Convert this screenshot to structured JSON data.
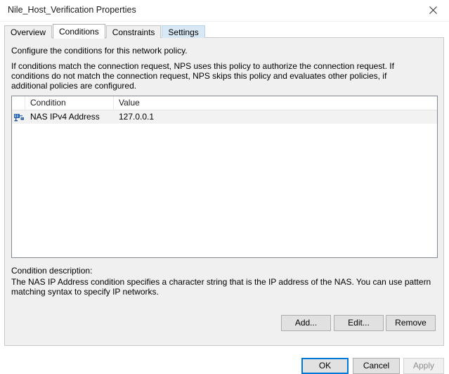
{
  "window": {
    "title": "Nile_Host_Verification Properties",
    "close_icon": "close-icon"
  },
  "tabs": [
    {
      "label": "Overview",
      "state": "normal"
    },
    {
      "label": "Conditions",
      "state": "selected"
    },
    {
      "label": "Constraints",
      "state": "normal"
    },
    {
      "label": "Settings",
      "state": "hover"
    }
  ],
  "body": {
    "intro": "Configure the conditions for this network policy.",
    "explanation": "If conditions match the connection request, NPS uses this policy to authorize the connection request. If conditions do not match the connection request, NPS skips this policy and evaluates other policies, if additional policies are configured."
  },
  "list": {
    "columns": [
      "Condition",
      "Value"
    ],
    "rows": [
      {
        "icon": "nas-network-icon",
        "condition": "NAS IPv4 Address",
        "value": "127.0.0.1",
        "selected": true
      }
    ]
  },
  "description": {
    "label": "Condition description:",
    "text": "The NAS IP Address condition specifies a character string that is the IP address of the NAS. You can use pattern matching syntax to specify IP networks."
  },
  "action_buttons": {
    "add": "Add...",
    "edit": "Edit...",
    "remove": "Remove"
  },
  "dialog_buttons": {
    "ok": "OK",
    "cancel": "Cancel",
    "apply": "Apply"
  },
  "colors": {
    "accent": "#0078d7",
    "window_bg": "#f0f0f0",
    "list_bg": "#ffffff",
    "row_selected": "#f2f2f2",
    "tab_hover": "#d8e9f5",
    "disabled_text": "#8d8d8d"
  }
}
